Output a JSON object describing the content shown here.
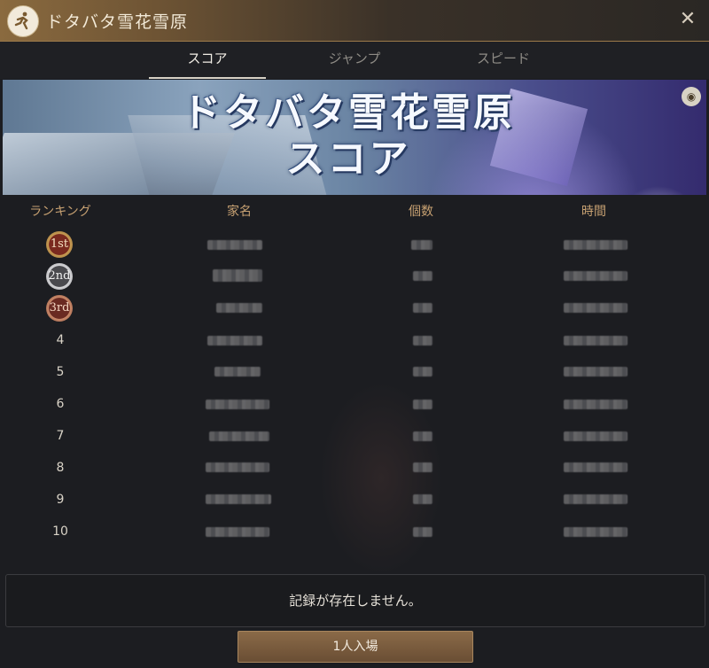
{
  "window": {
    "title": "ドタバタ雪花雪原",
    "close_symbol": "✕",
    "logo_icon": "running-person-icon"
  },
  "tabs": [
    {
      "label": "スコア",
      "active": true
    },
    {
      "label": "ジャンプ",
      "active": false
    },
    {
      "label": "スピード",
      "active": false
    }
  ],
  "banner": {
    "title_line1": "ドタバタ雪花雪原",
    "title_line2": "スコア",
    "corner_icon": "info-icon"
  },
  "table": {
    "headers": [
      "ランキング",
      "家名",
      "個数",
      "時間"
    ],
    "rows": [
      {
        "rank": "1",
        "medal": "1st",
        "tier": "gold"
      },
      {
        "rank": "2",
        "medal": "2nd",
        "tier": "silver"
      },
      {
        "rank": "3",
        "medal": "3rd",
        "tier": "bronze"
      },
      {
        "rank": "4"
      },
      {
        "rank": "5"
      },
      {
        "rank": "6"
      },
      {
        "rank": "7"
      },
      {
        "rank": "8"
      },
      {
        "rank": "9"
      },
      {
        "rank": "10"
      }
    ]
  },
  "notice": "記録が存在しません。",
  "enter_button": "1人入場",
  "colors": {
    "accent_gold": "#c7a172",
    "title_bar": "#8a6a3f",
    "button": "#7a5c3e"
  }
}
